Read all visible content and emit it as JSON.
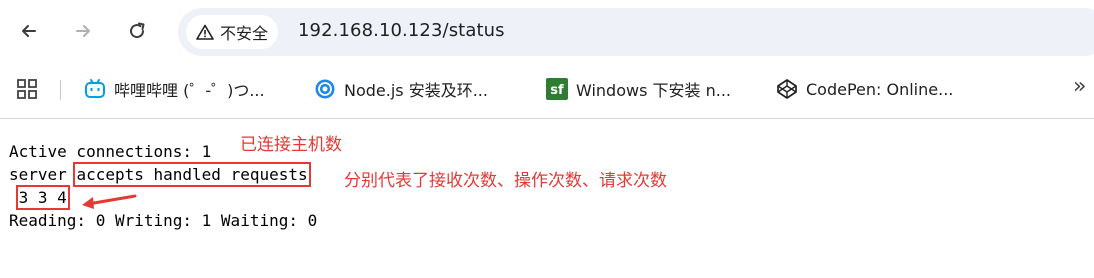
{
  "browser": {
    "security_label": "不安全",
    "url": "192.168.10.123/status"
  },
  "bookmarks": [
    {
      "label": "哔哩哔哩 (゜-゜)つ...",
      "icon": "bilibili-icon"
    },
    {
      "label": "Node.js 安装及环...",
      "icon": "site-icon"
    },
    {
      "label": "Windows 下安装 n...",
      "icon": "sf-icon"
    },
    {
      "label": "CodePen: Online...",
      "icon": "codepen-icon"
    }
  ],
  "page": {
    "line1": "Active connections: 1",
    "line2_prefix": "server ",
    "line2_boxed": "accepts handled requests",
    "line3": "3 3 4",
    "line4": "Reading: 0 Writing: 1 Waiting: 0"
  },
  "annotations": {
    "connected_hosts": "已连接主机数",
    "meaning": "分别代表了接收次数、操作次数、请求次数"
  },
  "colors": {
    "annotation_red": "#e53935"
  }
}
